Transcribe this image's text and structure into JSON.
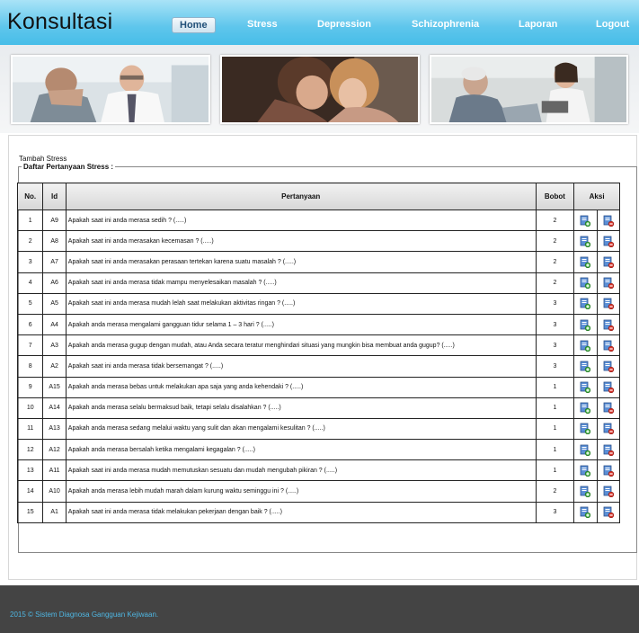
{
  "app": {
    "title": "Konsultasi"
  },
  "nav": [
    {
      "label": "Home",
      "active": true
    },
    {
      "label": "Stress",
      "active": false
    },
    {
      "label": "Depression",
      "active": false
    },
    {
      "label": "Schizophrenia",
      "active": false
    },
    {
      "label": "Laporan",
      "active": false
    },
    {
      "label": "Logout",
      "active": false
    }
  ],
  "content": {
    "add_link": "Tambah Stress",
    "legend": "Daftar Pertanyaan Stress :"
  },
  "table": {
    "headers": [
      "No.",
      "Id",
      "Pertanyaan",
      "Bobot",
      "Aksi"
    ],
    "rows": [
      {
        "no": "1",
        "id": "A9",
        "question": "Apakah saat ini anda merasa sedih ? (.....)",
        "weight": "2"
      },
      {
        "no": "2",
        "id": "A8",
        "question": "Apakah saat ini anda merasakan kecemasan ? (.....)",
        "weight": "2"
      },
      {
        "no": "3",
        "id": "A7",
        "question": "Apakah saat ini anda merasakan perasaan tertekan karena suatu masalah ? (.....)",
        "weight": "2"
      },
      {
        "no": "4",
        "id": "A6",
        "question": "Apakah saat ini anda merasa tidak mampu menyelesaikan masalah ? (.....)",
        "weight": "2"
      },
      {
        "no": "5",
        "id": "A5",
        "question": "Apakah saat ini anda merasa mudah lelah saat melakukan aktivitas ringan ? (.....)",
        "weight": "3"
      },
      {
        "no": "6",
        "id": "A4",
        "question": "Apakah anda merasa mengalami gangguan tidur selama 1 – 3 hari ? (.....)",
        "weight": "3"
      },
      {
        "no": "7",
        "id": "A3",
        "question": "Apakah anda merasa gugup dengan mudah, atau Anda secara teratur menghindari situasi yang mungkin bisa membuat anda gugup? (.....)",
        "weight": "3"
      },
      {
        "no": "8",
        "id": "A2",
        "question": "Apakah saat ini anda merasa tidak bersemangat ? (.....)",
        "weight": "3"
      },
      {
        "no": "9",
        "id": "A15",
        "question": "Apakah anda merasa bebas untuk melakukan apa saja yang anda kehendaki ? (.....)",
        "weight": "1"
      },
      {
        "no": "10",
        "id": "A14",
        "question": "Apakah anda merasa selalu bermaksud baik, tetapi selalu disalahkan ? (.....)",
        "weight": "1"
      },
      {
        "no": "11",
        "id": "A13",
        "question": "Apakah anda merasa sedang melalui waktu yang sulit dan akan mengalami kesulitan ? (.....)",
        "weight": "1"
      },
      {
        "no": "12",
        "id": "A12",
        "question": "Apakah anda merasa bersalah ketika mengalami kegagalan ? (.....)",
        "weight": "1"
      },
      {
        "no": "13",
        "id": "A11",
        "question": "Apakah saat ini anda merasa mudah memutuskan sesuatu dan mudah mengubah pikiran ? (.....)",
        "weight": "1"
      },
      {
        "no": "14",
        "id": "A10",
        "question": "Apakah anda merasa lebih mudah marah dalam kurung waktu seminggu ini ? (.....)",
        "weight": "2"
      },
      {
        "no": "15",
        "id": "A1",
        "question": "Apakah saat ini anda merasa tidak melakukan pekerjaan dengan baik ? (.....)",
        "weight": "3"
      }
    ],
    "actions": {
      "edit_icon": "edit-icon",
      "delete_icon": "delete-icon"
    }
  },
  "footer": {
    "text": "2015 © Sistem Diagnosa Gangguan Kejiwaan."
  },
  "colors": {
    "header": "#5ec6ec",
    "footer": "#444444",
    "footer_text": "#4fb6e2",
    "nav_text": "#ffffff"
  }
}
